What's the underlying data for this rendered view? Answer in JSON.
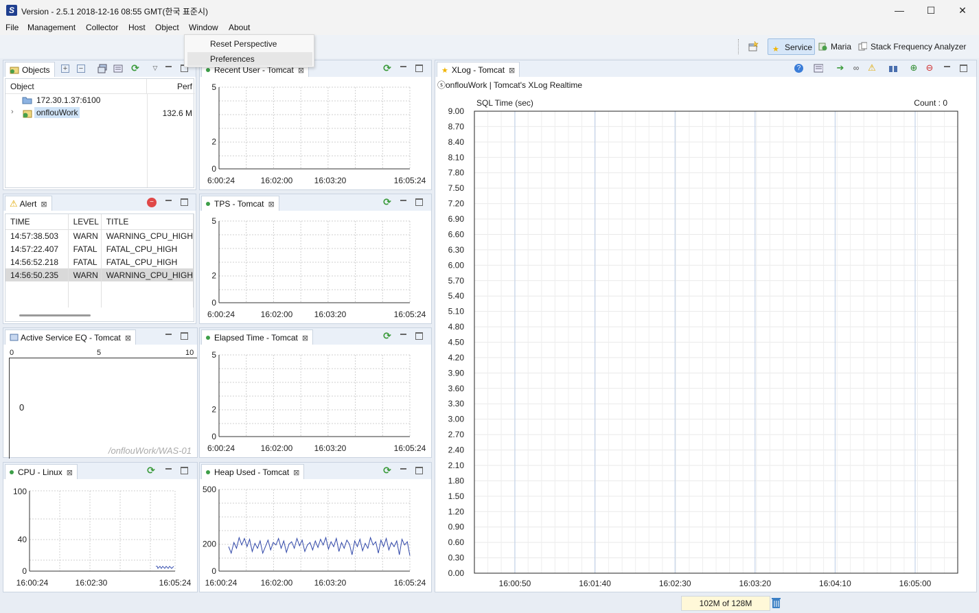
{
  "window": {
    "title": "Version - 2.5.1 2018-12-16 08:55 GMT(한국 표준시)",
    "app_icon": "S",
    "controls": {
      "minimize": "—",
      "maximize": "☐",
      "close": "✕"
    }
  },
  "menubar": [
    "File",
    "Management",
    "Collector",
    "Host",
    "Object",
    "Window",
    "About"
  ],
  "window_menu": [
    "Reset Perspective",
    "Preferences"
  ],
  "perspectives": [
    {
      "label": "Service",
      "active": true,
      "icon": "star-icon"
    },
    {
      "label": "Maria",
      "active": false,
      "icon": "db-icon"
    },
    {
      "label": "Stack Frequency Analyzer",
      "active": false,
      "icon": "stack-icon"
    }
  ],
  "objects": {
    "tab": "Objects",
    "columns": [
      "Object",
      "Perf"
    ],
    "rows": [
      {
        "name": "172.30.1.37:6100",
        "perf": ""
      },
      {
        "name": "onflouWork",
        "perf": "132.6 M"
      }
    ]
  },
  "alert": {
    "tab": "Alert",
    "columns": [
      "TIME",
      "LEVEL",
      "TITLE"
    ],
    "rows": [
      [
        "14:57:38.503",
        "WARN",
        "WARNING_CPU_HIGH"
      ],
      [
        "14:57:22.407",
        "FATAL",
        "FATAL_CPU_HIGH"
      ],
      [
        "14:56:52.218",
        "FATAL",
        "FATAL_CPU_HIGH"
      ],
      [
        "14:56:50.235",
        "WARN",
        "WARNING_CPU_HIGH"
      ]
    ]
  },
  "active_service": {
    "tab": "Active Service EQ - Tomcat",
    "scale": [
      "0",
      "5",
      "10"
    ],
    "value": "0",
    "path": "/onflouWork/WAS-01"
  },
  "recent_user": {
    "tab": "Recent User - Tomcat",
    "yticks": [
      "5",
      "2",
      "0"
    ],
    "xticks": [
      "6:00:24",
      "16:02:00",
      "16:03:20",
      "16:05:24"
    ]
  },
  "tps": {
    "tab": "TPS - Tomcat",
    "yticks": [
      "5",
      "2",
      "0"
    ],
    "xticks": [
      "6:00:24",
      "16:02:00",
      "16:03:20",
      "16:05:24"
    ]
  },
  "elapsed": {
    "tab": "Elapsed Time - Tomcat",
    "yticks": [
      "5",
      "2",
      "0"
    ],
    "xticks": [
      "6:00:24",
      "16:02:00",
      "16:03:20",
      "16:05:24"
    ]
  },
  "cpu": {
    "tab": "CPU - Linux",
    "yticks": [
      "100",
      "40",
      "0"
    ],
    "xticks": [
      "16:00:24",
      "16:02:30",
      "16:05:24"
    ]
  },
  "heap": {
    "tab": "Heap Used - Tomcat",
    "yticks": [
      "500",
      "200",
      "0"
    ],
    "xticks": [
      "16:00:24",
      "16:02:00",
      "16:03:20",
      "16:05:24"
    ],
    "values": [
      150,
      110,
      175,
      140,
      205,
      160,
      200,
      150,
      195,
      120,
      170,
      140,
      185,
      110,
      150,
      190,
      130,
      175,
      160,
      200,
      140,
      185,
      115,
      165,
      180,
      140,
      200,
      155,
      190,
      120,
      160,
      175,
      130,
      185,
      145,
      195,
      160,
      205,
      135,
      180,
      150,
      200,
      120,
      175,
      140,
      190,
      165,
      100,
      185,
      150,
      195,
      125,
      170,
      140,
      205,
      160,
      180,
      110,
      190,
      150,
      200,
      130,
      175,
      150,
      185,
      100,
      195,
      160,
      180,
      95
    ]
  },
  "xlog": {
    "tab": "XLog - Tomcat",
    "subtitle": "ⓢonflouWork | Tomcat's XLog Realtime",
    "ylabel": "SQL Time (sec)",
    "count": "Count : 0",
    "yticks": [
      "9.00",
      "8.70",
      "8.40",
      "8.10",
      "7.80",
      "7.50",
      "7.20",
      "6.90",
      "6.60",
      "6.30",
      "6.00",
      "5.70",
      "5.40",
      "5.10",
      "4.80",
      "4.50",
      "4.20",
      "3.90",
      "3.60",
      "3.30",
      "3.00",
      "2.70",
      "2.40",
      "2.10",
      "1.80",
      "1.50",
      "1.20",
      "0.90",
      "0.60",
      "0.30",
      "0.00"
    ],
    "xticks": [
      "16:00:50",
      "16:01:40",
      "16:02:30",
      "16:03:20",
      "16:04:10",
      "16:05:00"
    ]
  },
  "status": {
    "memory": "102M of 128M"
  }
}
